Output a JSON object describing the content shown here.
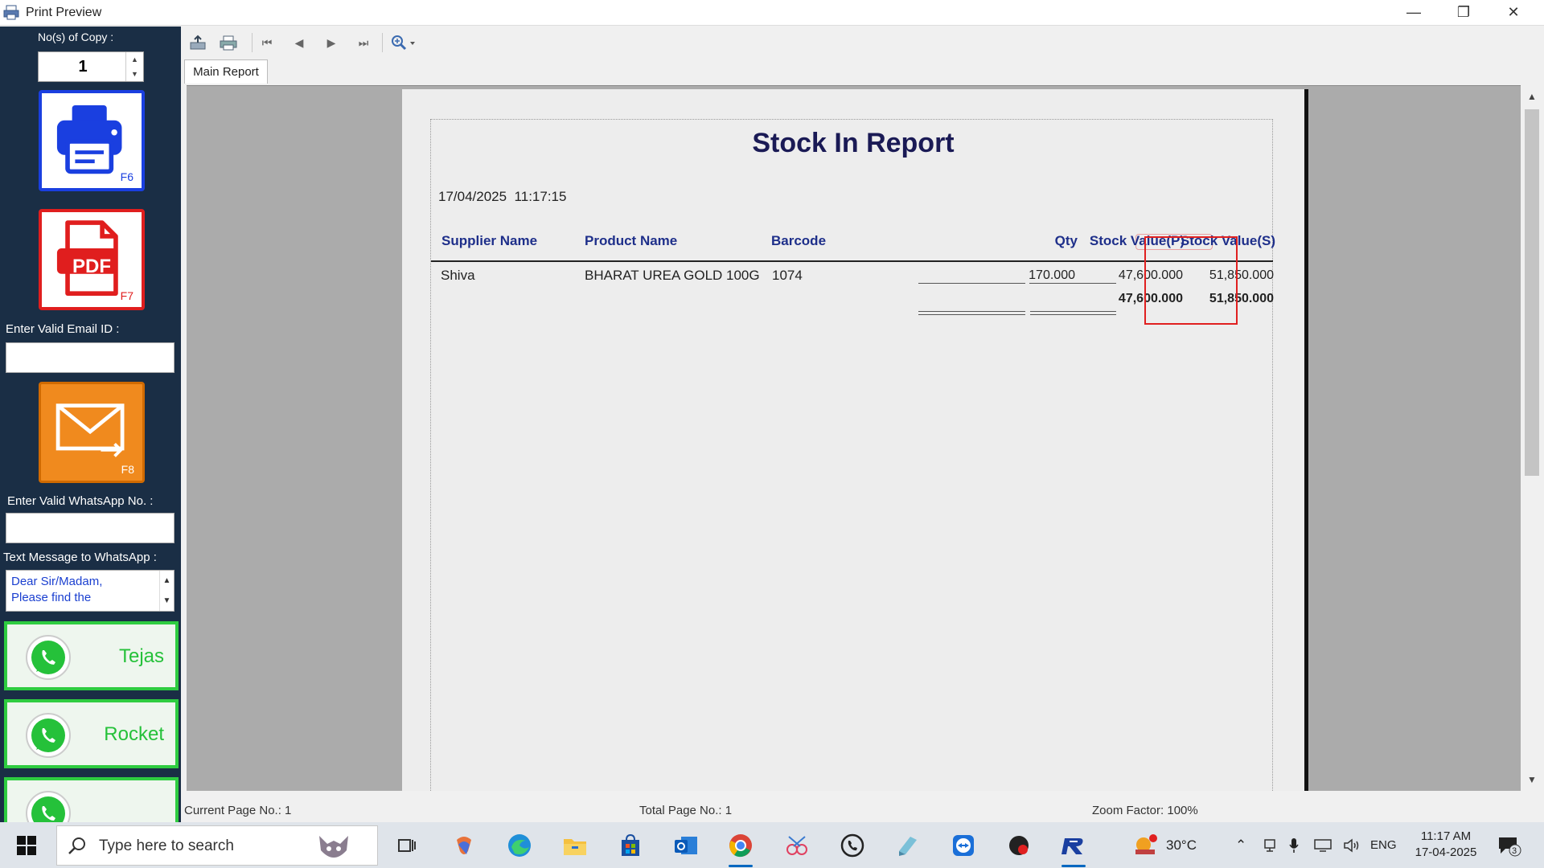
{
  "window": {
    "title": "Print Preview",
    "minimize": "—",
    "restore": "❐",
    "close": "✕"
  },
  "left_panel": {
    "copies_label": "No(s) of Copy :",
    "copies_value": "1",
    "print_key": "F6",
    "pdf_key": "F7",
    "pdf_text": "PDF",
    "email_label": "Enter Valid Email ID :",
    "email_value": "",
    "email_key": "F8",
    "whatsapp_no_label": "Enter Valid WhatsApp No. :",
    "whatsapp_no_value": "",
    "whatsapp_msg_label": "Text Message to WhatsApp :",
    "whatsapp_msg": "Dear Sir/Madam,\nPlease find the",
    "contacts": [
      "Tejas",
      "Rocket"
    ]
  },
  "tabs": {
    "main_report": "Main Report"
  },
  "report": {
    "title": "Stock In Report",
    "date": "17/04/2025",
    "time": "11:17:15",
    "columns": {
      "supplier": "Supplier Name",
      "product": "Product Name",
      "barcode": "Barcode",
      "qty": "Qty",
      "stock_p": "Stock Value(P)",
      "stock_s": "Stock Value(S)"
    },
    "rows": [
      {
        "supplier": "Shiva",
        "product": "BHARAT UREA GOLD 100G",
        "barcode": "1074",
        "qty": "170.000",
        "stock_p": "47,600.000",
        "stock_s": "51,850.000"
      }
    ],
    "totals": {
      "stock_p": "47,600.000",
      "stock_s": "51,850.000"
    }
  },
  "status": {
    "current_page": "Current Page No.: 1",
    "total_pages": "Total Page No.: 1",
    "zoom": "Zoom Factor: 100%"
  },
  "taskbar": {
    "search_placeholder": "Type here to search",
    "weather": "30°C",
    "language": "ENG",
    "time": "11:17 AM",
    "date": "17-04-2025",
    "notifications": "3"
  },
  "colors": {
    "panel": "#1a2e45",
    "whatsapp": "#25c13a",
    "highlight": "#e02020",
    "report_header": "#1e2f8a"
  }
}
